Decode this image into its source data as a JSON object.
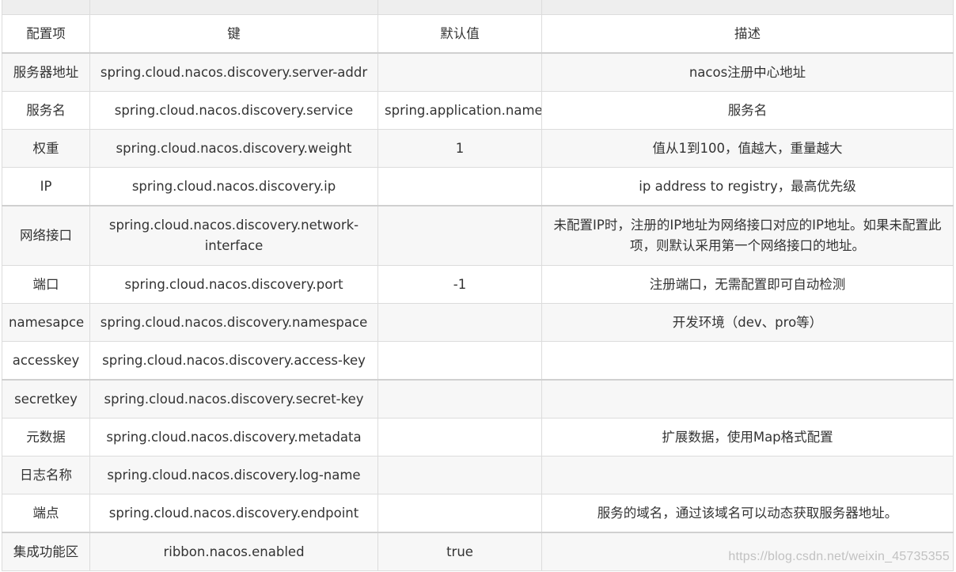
{
  "header": {
    "col1": "配置项",
    "col2": "键",
    "col3": "默认值",
    "col4": "描述"
  },
  "rows": [
    {
      "item": "服务器地址",
      "key": "spring.cloud.nacos.discovery.server-addr",
      "default": "",
      "desc": "nacos注册中心地址"
    },
    {
      "item": "服务名",
      "key": "spring.cloud.nacos.discovery.service",
      "default": "spring.application.name",
      "desc": "服务名"
    },
    {
      "item": "权重",
      "key": "spring.cloud.nacos.discovery.weight",
      "default": "1",
      "desc": "值从1到100，值越大，重量越大"
    },
    {
      "item": "IP",
      "key": "spring.cloud.nacos.discovery.ip",
      "default": "",
      "desc": "ip address to registry，最高优先级"
    },
    {
      "item": "网络接口",
      "key": "spring.cloud.nacos.discovery.network-interface",
      "default": "",
      "desc": "未配置IP时，注册的IP地址为网络接口对应的IP地址。如果未配置此项，则默认采用第一个网络接口的地址。"
    },
    {
      "item": "端口",
      "key": "spring.cloud.nacos.discovery.port",
      "default": "-1",
      "desc": "注册端口，无需配置即可自动检测"
    },
    {
      "item": "namesapce",
      "key": "spring.cloud.nacos.discovery.namespace",
      "default": "",
      "desc": "开发环境（dev、pro等）"
    },
    {
      "item": "accesskey",
      "key": "spring.cloud.nacos.discovery.access-key",
      "default": "",
      "desc": ""
    },
    {
      "item": "secretkey",
      "key": "spring.cloud.nacos.discovery.secret-key",
      "default": "",
      "desc": ""
    },
    {
      "item": "元数据",
      "key": "spring.cloud.nacos.discovery.metadata",
      "default": "",
      "desc": "扩展数据，使用Map格式配置"
    },
    {
      "item": "日志名称",
      "key": "spring.cloud.nacos.discovery.log-name",
      "default": "",
      "desc": ""
    },
    {
      "item": "端点",
      "key": "spring.cloud.nacos.discovery.endpoint",
      "default": "",
      "desc": "服务的域名，通过该域名可以动态获取服务器地址。"
    },
    {
      "item": "集成功能区",
      "key": "ribbon.nacos.enabled",
      "default": "true",
      "desc": ""
    }
  ],
  "watermark": "https://blog.csdn.net/weixin_45735355"
}
